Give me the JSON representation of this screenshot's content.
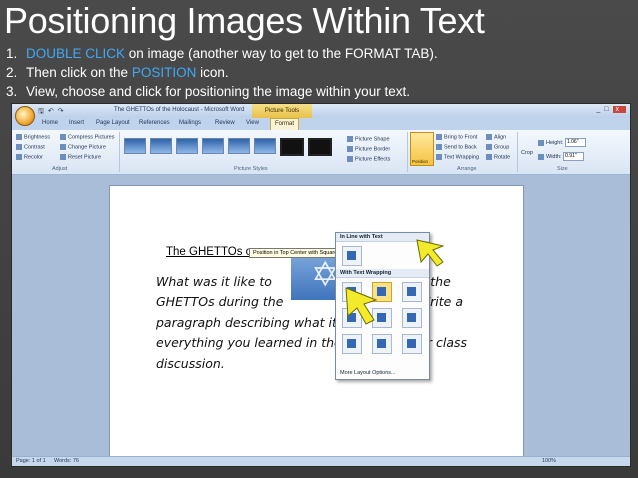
{
  "slide": {
    "title": "Positioning Images Within Text",
    "steps": [
      {
        "num": "1.",
        "hl": "DOUBLE CLICK",
        "text": " on image (another way to get to the FORMAT TAB)."
      },
      {
        "num": "2.",
        "pre": "Then click on the ",
        "hl": "POSITION",
        "text": " icon."
      },
      {
        "num": "3.",
        "text": "View, choose and click for positioning the image within your text."
      }
    ],
    "accent_color": "#3fa9f5"
  },
  "word": {
    "window_title": "The GHETTOs of the Holocaust - Microsoft Word",
    "picture_tools": "Picture Tools",
    "tabs": [
      "Home",
      "Insert",
      "Page Layout",
      "References",
      "Mailings",
      "Review",
      "View",
      "Format"
    ],
    "active_tab": "Format",
    "ribbon": {
      "adjust": {
        "brightness": "Brightness",
        "contrast": "Contrast",
        "recolor": "Recolor",
        "compress": "Compress Pictures",
        "change": "Change Picture",
        "reset": "Reset Picture",
        "label": "Adjust"
      },
      "styles_label": "Picture Styles",
      "picture_shape": "Picture Shape",
      "picture_border": "Picture Border",
      "picture_effects": "Picture Effects",
      "position": "Position",
      "arrange": {
        "bring_front": "Bring to Front",
        "send_back": "Send to Back",
        "text_wrapping": "Text Wrapping",
        "align": "Align",
        "group": "Group",
        "rotate": "Rotate",
        "label": "Arrange"
      },
      "size": {
        "crop": "Crop",
        "height_label": "Height:",
        "height": "1.06\"",
        "width_label": "Width:",
        "width": "0.91\"",
        "label": "Size"
      }
    },
    "dropdown": {
      "inline_header": "In Line with Text",
      "wrap_header": "With Text Wrapping",
      "more": "More Layout Options..."
    },
    "tooltip": "Position in Top Center with Square Text Wrapping",
    "document": {
      "title": "The GHETTOs o",
      "title_end": "st",
      "lines": [
        "What was it like to",
        "g in the",
        "GHETTOs during the",
        "Write a",
        "paragraph describing what it was like using",
        "everything you learned in the video and our class",
        "discussion."
      ]
    },
    "status": {
      "page": "Page: 1 of 1",
      "words": "Words: 76",
      "zoom": "100%"
    }
  }
}
